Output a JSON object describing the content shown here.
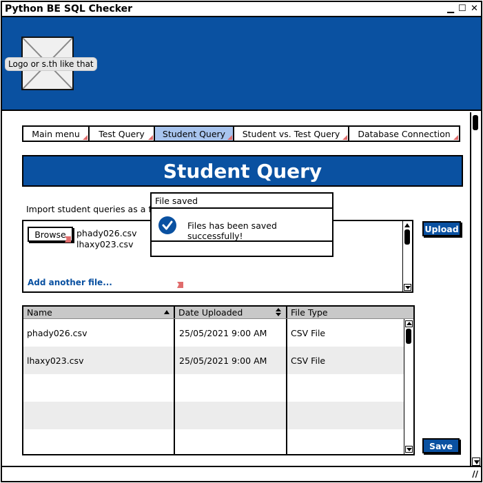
{
  "window": {
    "title": "Python BE SQL Checker",
    "minimize": "▁",
    "maximize": "☐",
    "close": "✕"
  },
  "header": {
    "logo_tooltip": "Logo or s.th like that",
    "background_color": "#0a51a1"
  },
  "tabs": [
    {
      "label": "Main menu",
      "active": false
    },
    {
      "label": "Test Query",
      "active": false
    },
    {
      "label": "Student Query",
      "active": true
    },
    {
      "label": "Student vs. Test Query",
      "active": false
    },
    {
      "label": "Database Connection",
      "active": false
    }
  ],
  "page_title": "Student Query",
  "import": {
    "label": "Import student queries as a file",
    "browse_label": "Browse",
    "files": [
      "phady026.csv",
      "lhaxy023.csv"
    ],
    "add_file_label": "Add another file...",
    "upload_label": "Upload"
  },
  "dialog": {
    "title": "File saved",
    "message": "Files has been saved successfully!"
  },
  "table": {
    "columns": [
      {
        "label": "Name",
        "sort": "ascending"
      },
      {
        "label": "Date Uploaded",
        "sort": "both"
      },
      {
        "label": "File Type",
        "sort": "none"
      }
    ],
    "rows": [
      {
        "name": "phady026.csv",
        "date": "25/05/2021  9:00 AM",
        "type": "CSV File"
      },
      {
        "name": "lhaxy023.csv",
        "date": "25/05/2021  9:00 AM",
        "type": "CSV File"
      },
      {
        "name": "",
        "date": "",
        "type": ""
      },
      {
        "name": "",
        "date": "",
        "type": ""
      },
      {
        "name": "",
        "date": "",
        "type": ""
      }
    ]
  },
  "save_label": "Save",
  "accent_color": "#0a51a1",
  "active_tab_color": "#a8c4ee"
}
